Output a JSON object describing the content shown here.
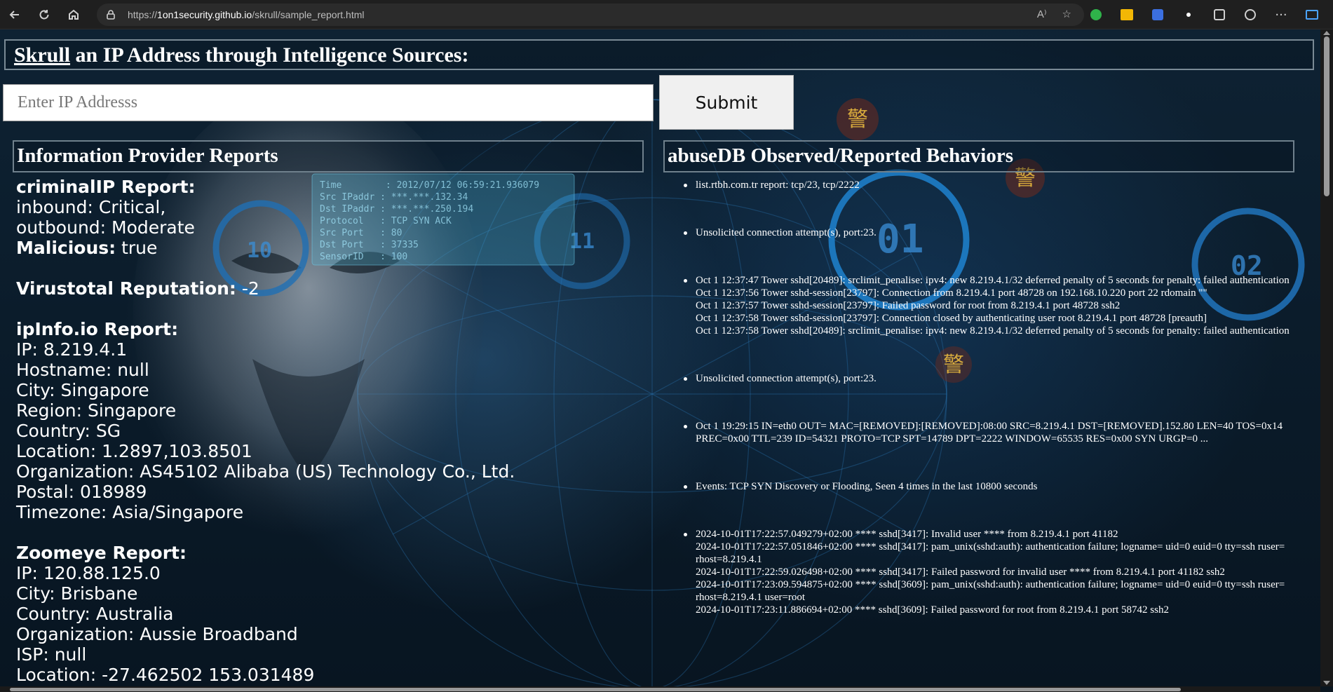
{
  "browser": {
    "url_prefix": "https://",
    "url_host": "1on1security.github.io",
    "url_path": "/skrull/sample_report.html",
    "read_aloud_label": "A⁾"
  },
  "header": {
    "title_link": "Skrull",
    "title_rest": " an IP Address through Intelligence Sources:"
  },
  "search": {
    "placeholder": "Enter IP Addresss",
    "submit_label": "Submit"
  },
  "left_section": {
    "heading": "Information Provider Reports",
    "criminalip": {
      "title": "criminalIP Report:",
      "inbound": "inbound: Critical,",
      "outbound": "outbound: Moderate",
      "malicious_label": "Malicious:",
      "malicious_value": " true"
    },
    "virustotal": {
      "label": "Virustotal Reputation:",
      "value": " -2"
    },
    "ipinfo": {
      "title": "ipInfo.io Report:",
      "lines": [
        "IP: 8.219.4.1",
        "Hostname: null",
        "City: Singapore",
        "Region: Singapore",
        "Country: SG",
        "Location: 1.2897,103.8501",
        "Organization: AS45102 Alibaba (US) Technology Co., Ltd.",
        "Postal: 018989",
        "Timezone: Asia/Singapore"
      ]
    },
    "zoomeye": {
      "title": "Zoomeye Report:",
      "lines": [
        "IP: 120.88.125.0",
        "City: Brisbane",
        "Country: Australia",
        "Organization: Aussie Broadband",
        "ISP: null",
        "Location: -27.462502 153.031489"
      ]
    }
  },
  "right_section": {
    "heading": "abuseDB Observed/Reported Behaviors",
    "items": [
      [
        "list.rtbh.com.tr report: tcp/23, tcp/2222"
      ],
      [
        "Unsolicited connection attempt(s), port:23."
      ],
      [
        "Oct 1 12:37:47 Tower sshd[20489]: srclimit_penalise: ipv4: new 8.219.4.1/32 deferred penalty of 5 seconds for penalty: failed authentication",
        "Oct 1 12:37:56 Tower sshd-session[23797]: Connection from 8.219.4.1 port 48728 on 192.168.10.220 port 22 rdomain \"\"",
        "Oct 1 12:37:57 Tower sshd-session[23797]: Failed password for root from 8.219.4.1 port 48728 ssh2",
        "Oct 1 12:37:58 Tower sshd-session[23797]: Connection closed by authenticating user root 8.219.4.1 port 48728 [preauth]",
        "Oct 1 12:37:58 Tower sshd[20489]: srclimit_penalise: ipv4: new 8.219.4.1/32 deferred penalty of 5 seconds for penalty: failed authentication"
      ],
      [
        "Unsolicited connection attempt(s), port:23."
      ],
      [
        "Oct 1 19:29:15 IN=eth0 OUT= MAC=[REMOVED]:[REMOVED]:08:00 SRC=8.219.4.1 DST=[REMOVED].152.80 LEN=40 TOS=0x14 PREC=0x00 TTL=239 ID=54321 PROTO=TCP SPT=14789 DPT=2222 WINDOW=65535 RES=0x00 SYN URGP=0 ..."
      ],
      [
        "Events: TCP SYN Discovery or Flooding, Seen 4 times in the last 10800 seconds"
      ],
      [
        "2024-10-01T17:22:57.049279+02:00 **** sshd[3417]: Invalid user **** from 8.219.4.1 port 41182",
        "2024-10-01T17:22:57.051846+02:00 **** sshd[3417]: pam_unix(sshd:auth): authentication failure; logname= uid=0 euid=0 tty=ssh ruser= rhost=8.219.4.1",
        "2024-10-01T17:22:59.026498+02:00 **** sshd[3417]: Failed password for invalid user **** from 8.219.4.1 port 41182 ssh2",
        "2024-10-01T17:23:09.594875+02:00 **** sshd[3609]: pam_unix(sshd:auth): authentication failure; logname= uid=0 euid=0 tty=ssh ruser= rhost=8.219.4.1 user=root",
        "2024-10-01T17:23:11.886694+02:00 **** sshd[3609]: Failed password for root from 8.219.4.1 port 58742 ssh2"
      ]
    ]
  },
  "background_art": {
    "overlay_lines": [
      "Time        : 2012/07/12 06:59:21.936079",
      "Src IPaddr : ***.***.132.34",
      "Dst IPaddr : ***.***.250.194",
      "Protocol   : TCP SYN ACK",
      "Src Port   : 80",
      "Dst Port   : 37335",
      "SensorID   : 100"
    ],
    "dial_labels": [
      "10",
      "11",
      "01",
      "02"
    ],
    "badge_glyph": "警"
  },
  "colors": {
    "chrome_bg": "#1f1f1f",
    "page_bg": "#0b1620",
    "accent_cyan": "#1e90d8"
  }
}
